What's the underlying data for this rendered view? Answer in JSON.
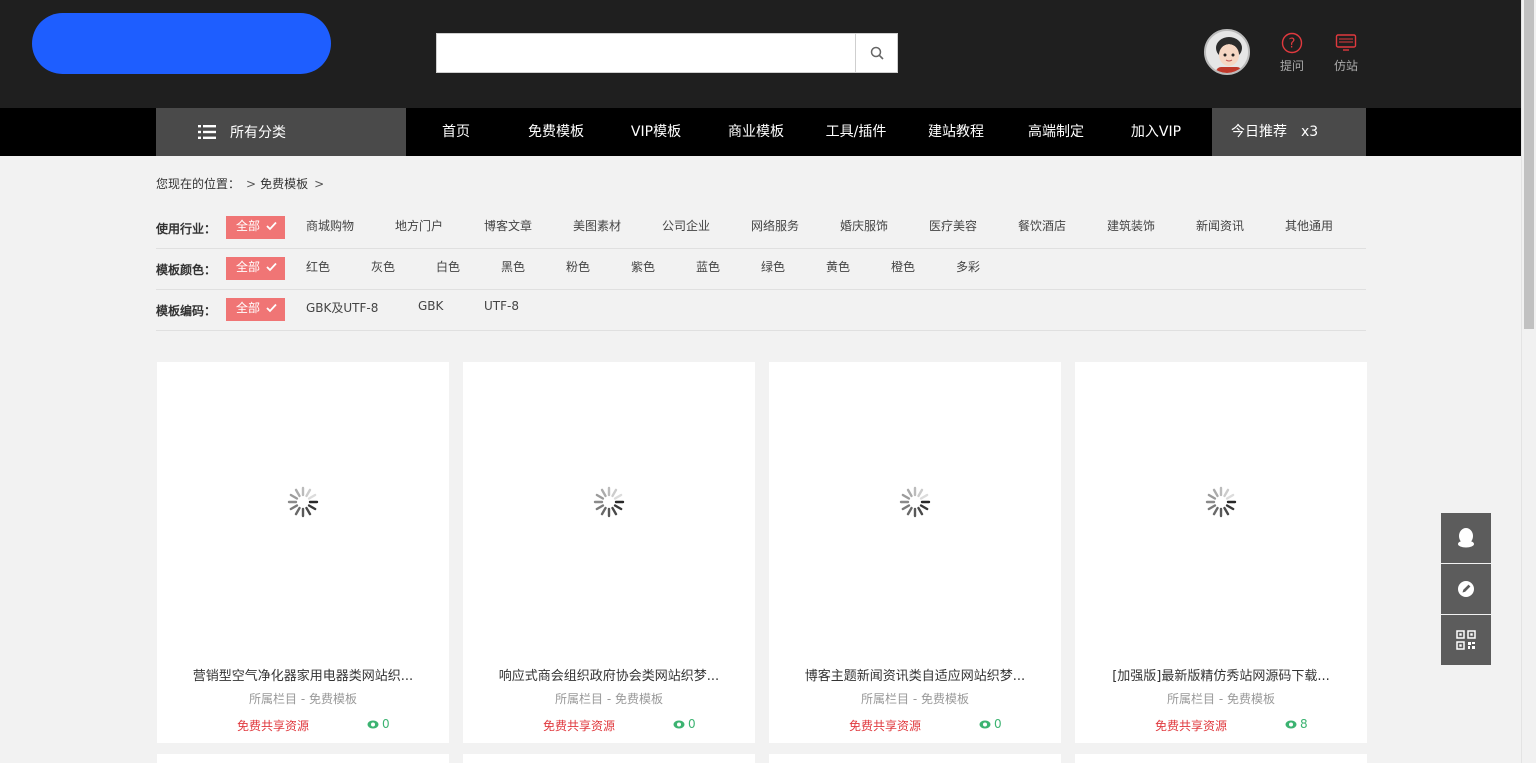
{
  "header": {
    "search": {
      "value": "",
      "placeholder": ""
    },
    "actions": [
      {
        "label": "提问",
        "icon": "question-icon"
      },
      {
        "label": "仿站",
        "icon": "monitor-icon"
      }
    ]
  },
  "nav": {
    "category_label": "所有分类",
    "items": [
      "首页",
      "免费模板",
      "VIP模板",
      "商业模板",
      "工具/插件",
      "建站教程",
      "高端制定",
      "加入VIP"
    ],
    "recommend_label": "今日推荐",
    "recommend_count": "x3"
  },
  "breadcrumb": {
    "prefix": "您现在的位置：",
    "items": [
      "免费模板"
    ]
  },
  "filters": [
    {
      "label": "使用行业：",
      "all": "全部",
      "options": [
        "商城购物",
        "地方门户",
        "博客文章",
        "美图素材",
        "公司企业",
        "网络服务",
        "婚庆服饰",
        "医疗美容",
        "餐饮酒店",
        "建筑装饰",
        "新闻资讯",
        "其他通用"
      ]
    },
    {
      "label": "模板颜色：",
      "all": "全部",
      "options": [
        "红色",
        "灰色",
        "白色",
        "黑色",
        "粉色",
        "紫色",
        "蓝色",
        "绿色",
        "黄色",
        "橙色",
        "多彩"
      ]
    },
    {
      "label": "模板编码：",
      "all": "全部",
      "options": [
        "GBK及UTF-8",
        "GBK",
        "UTF-8"
      ]
    }
  ],
  "cards": [
    {
      "title": "营销型空气净化器家用电器类网站织...",
      "meta": "所属栏目 - 免费模板",
      "price": "免费共享资源",
      "views": "0"
    },
    {
      "title": "响应式商会组织政府协会类网站织梦...",
      "meta": "所属栏目 - 免费模板",
      "price": "免费共享资源",
      "views": "0"
    },
    {
      "title": "博客主题新闻资讯类自适应网站织梦...",
      "meta": "所属栏目 - 免费模板",
      "price": "免费共享资源",
      "views": "0"
    },
    {
      "title": "[加强版]最新版精仿秀站网源码下载...",
      "meta": "所属栏目 - 免费模板",
      "price": "免费共享资源",
      "views": "8"
    }
  ],
  "side_tools": [
    "qq-icon",
    "edit-icon",
    "qrcode-icon"
  ],
  "colors": {
    "header_bg": "#1f1f1f",
    "nav_bg": "#000000",
    "logo_blue": "#1e5eff",
    "filter_active": "#f07575",
    "accent_red": "#e0393e",
    "views_green": "#3cb371"
  }
}
